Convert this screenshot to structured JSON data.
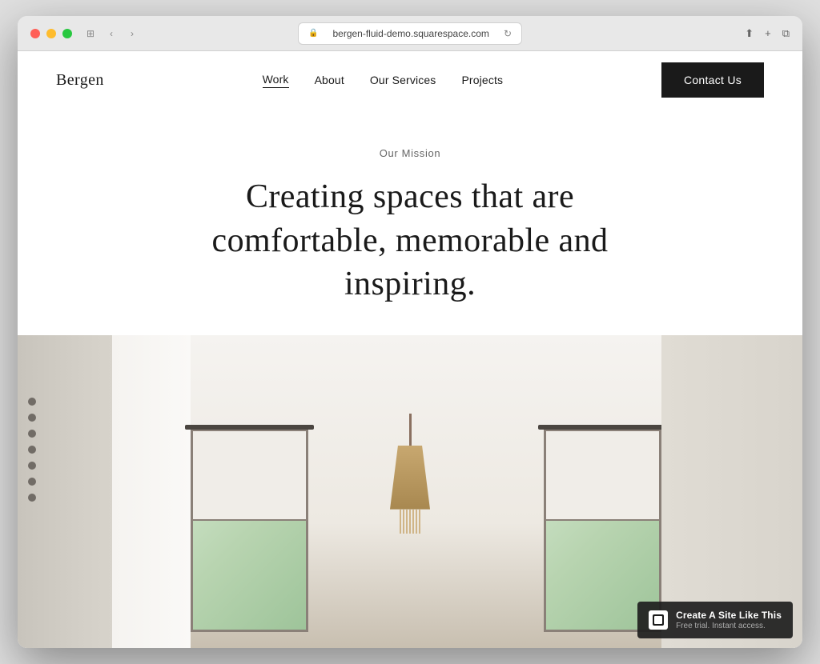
{
  "browser": {
    "url": "bergen-fluid-demo.squarespace.com",
    "lock_icon": "🔒",
    "refresh_icon": "↻",
    "back_icon": "‹",
    "forward_icon": "›",
    "window_icon": "⊞",
    "share_icon": "⬆",
    "add_tab_icon": "+",
    "tabs_icon": "⧉"
  },
  "site": {
    "logo": "Bergen",
    "nav": {
      "links": [
        {
          "label": "Work",
          "active": true
        },
        {
          "label": "About",
          "active": false
        },
        {
          "label": "Our Services",
          "active": false
        },
        {
          "label": "Projects",
          "active": false
        }
      ],
      "contact_button": "Contact Us"
    },
    "hero": {
      "label": "Our Mission",
      "title": "Creating spaces that are comfortable, memorable and inspiring."
    },
    "squarespace": {
      "title": "Create A Site Like This",
      "subtitle": "Free trial. Instant access."
    }
  }
}
